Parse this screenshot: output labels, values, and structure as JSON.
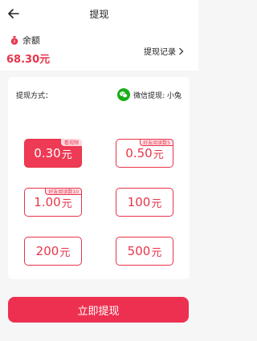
{
  "header": {
    "title": "提现",
    "back_icon": "arrow-left-icon"
  },
  "balance": {
    "label": "余额",
    "amount": "68.30元",
    "icon": "money-bag-icon",
    "history_label": "提现记录",
    "history_icon": "chevron-right-icon"
  },
  "method": {
    "label": "提现方式：",
    "value": "微信提现: 小兔",
    "icon": "wechat-icon",
    "icon_color": "#1aad19"
  },
  "options": [
    {
      "amount": "0.30",
      "unit": "元",
      "badge": "看视频",
      "selected": true
    },
    {
      "amount": "0.50",
      "unit": "元",
      "badge": "好友阅读数5",
      "selected": false
    },
    {
      "amount": "1.00",
      "unit": "元",
      "badge": "好友阅读数10",
      "selected": false
    },
    {
      "amount": "100",
      "unit": "元",
      "badge": "",
      "selected": false
    },
    {
      "amount": "200",
      "unit": "元",
      "badge": "",
      "selected": false
    },
    {
      "amount": "500",
      "unit": "元",
      "badge": "",
      "selected": false
    }
  ],
  "submit": {
    "label": "立即提现"
  },
  "colors": {
    "accent": "#e8344b",
    "submit": "#ee3050"
  }
}
